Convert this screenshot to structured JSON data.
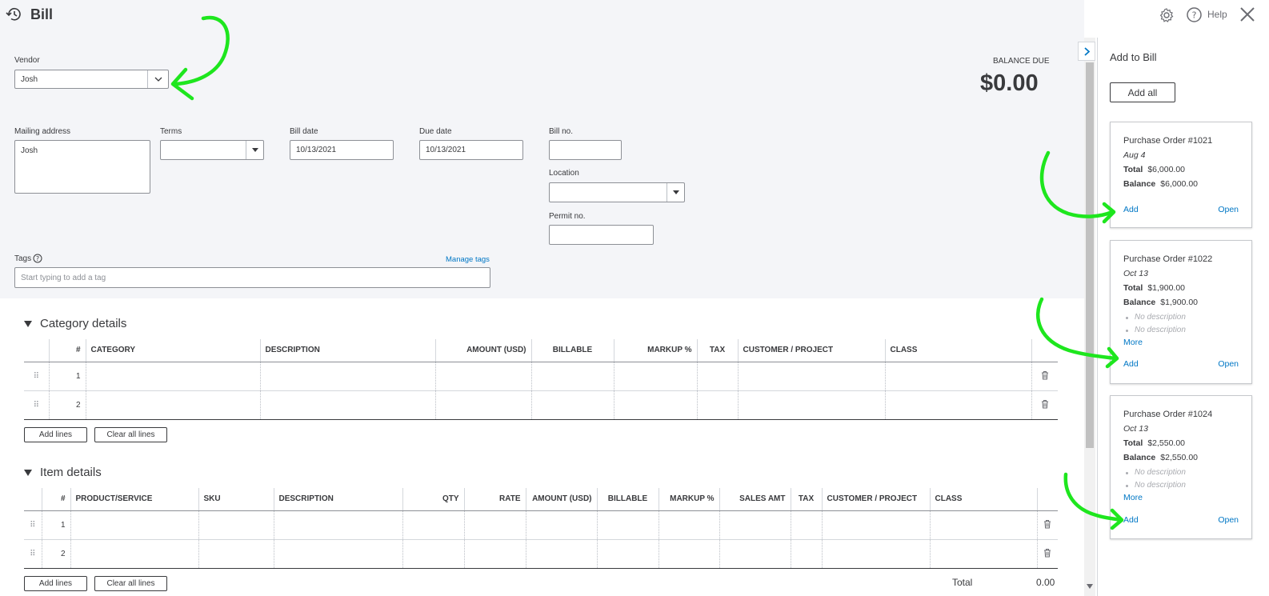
{
  "title": "Bill",
  "header": {
    "help_label": "Help"
  },
  "vendor": {
    "label": "Vendor",
    "value": "Josh"
  },
  "balance": {
    "label": "BALANCE DUE",
    "value": "$0.00"
  },
  "form": {
    "mailing_label": "Mailing address",
    "mailing_value": "Josh",
    "terms_label": "Terms",
    "terms_value": "",
    "bill_date_label": "Bill date",
    "bill_date_value": "10/13/2021",
    "due_date_label": "Due date",
    "due_date_value": "10/13/2021",
    "bill_no_label": "Bill no.",
    "bill_no_value": "",
    "location_label": "Location",
    "location_value": "",
    "permit_label": "Permit no.",
    "permit_value": "",
    "tags_label": "Tags",
    "manage_tags": "Manage tags",
    "tags_placeholder": "Start typing to add a tag"
  },
  "category": {
    "heading": "Category details",
    "columns": [
      "#",
      "CATEGORY",
      "DESCRIPTION",
      "AMOUNT (USD)",
      "BILLABLE",
      "MARKUP %",
      "TAX",
      "CUSTOMER / PROJECT",
      "CLASS"
    ],
    "rows": [
      "1",
      "2"
    ],
    "add_lines": "Add lines",
    "clear_lines": "Clear all lines"
  },
  "items": {
    "heading": "Item details",
    "columns": [
      "#",
      "PRODUCT/SERVICE",
      "SKU",
      "DESCRIPTION",
      "QTY",
      "RATE",
      "AMOUNT (USD)",
      "BILLABLE",
      "MARKUP %",
      "SALES AMT",
      "TAX",
      "CUSTOMER / PROJECT",
      "CLASS"
    ],
    "rows": [
      "1",
      "2"
    ],
    "add_lines": "Add lines",
    "clear_lines": "Clear all lines",
    "total_label": "Total",
    "total_value": "0.00"
  },
  "sidebar": {
    "title": "Add to Bill",
    "add_all": "Add all",
    "cards": [
      {
        "title": "Purchase Order #1021",
        "date": "Aug 4",
        "total_label": "Total",
        "total": "$6,000.00",
        "balance_label": "Balance",
        "balance": "$6,000.00",
        "descriptions": [],
        "more": "",
        "add": "Add",
        "open": "Open"
      },
      {
        "title": "Purchase Order #1022",
        "date": "Oct 13",
        "total_label": "Total",
        "total": "$1,900.00",
        "balance_label": "Balance",
        "balance": "$1,900.00",
        "descriptions": [
          "No description",
          "No description"
        ],
        "more": "More",
        "add": "Add",
        "open": "Open"
      },
      {
        "title": "Purchase Order #1024",
        "date": "Oct 13",
        "total_label": "Total",
        "total": "$2,550.00",
        "balance_label": "Balance",
        "balance": "$2,550.00",
        "descriptions": [
          "No description",
          "No description"
        ],
        "more": "More",
        "add": "Add",
        "open": "Open"
      }
    ]
  },
  "colors": {
    "annotation": "#1ee61e",
    "link": "#0077c5",
    "text": "#393a3d"
  },
  "icons": [
    "history-icon",
    "gear-icon",
    "help-icon",
    "close-icon",
    "chevron-right-icon",
    "chevron-down-icon",
    "caret-down-icon",
    "drag-handle-icon",
    "trash-icon",
    "info-icon"
  ]
}
